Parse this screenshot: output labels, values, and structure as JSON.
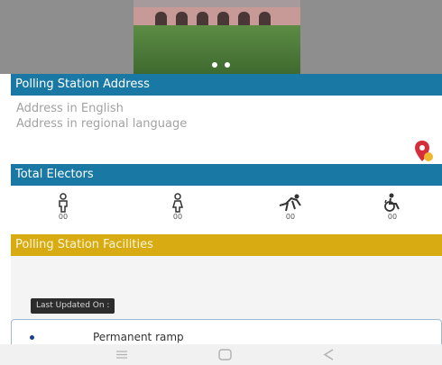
{
  "address_section": {
    "title": "Polling Station Address",
    "address_english": "Address in English",
    "address_regional": "Address in regional language",
    "map_icon": "map-pin-icon"
  },
  "electors_section": {
    "title": "Total Electors",
    "items": [
      {
        "icon": "male-voter-icon",
        "count": "00"
      },
      {
        "icon": "female-voter-icon",
        "count": "00"
      },
      {
        "icon": "third-gender-voter-icon",
        "count": "00"
      },
      {
        "icon": "disabled-voter-icon",
        "count": "00"
      }
    ]
  },
  "facilities_section": {
    "title": "Polling Station Facilities",
    "last_updated": "Last Updated On :",
    "facilities": [
      "Permanent ramp"
    ]
  },
  "carousel": {
    "dots": 2
  },
  "navbar": {
    "icons": [
      "recents-icon",
      "home-icon",
      "back-icon"
    ]
  },
  "colors": {
    "blue": "#1979a4",
    "yellow": "#d7ab11",
    "pin_red": "#d62d3b",
    "pin_yellow": "#f0b62d"
  }
}
